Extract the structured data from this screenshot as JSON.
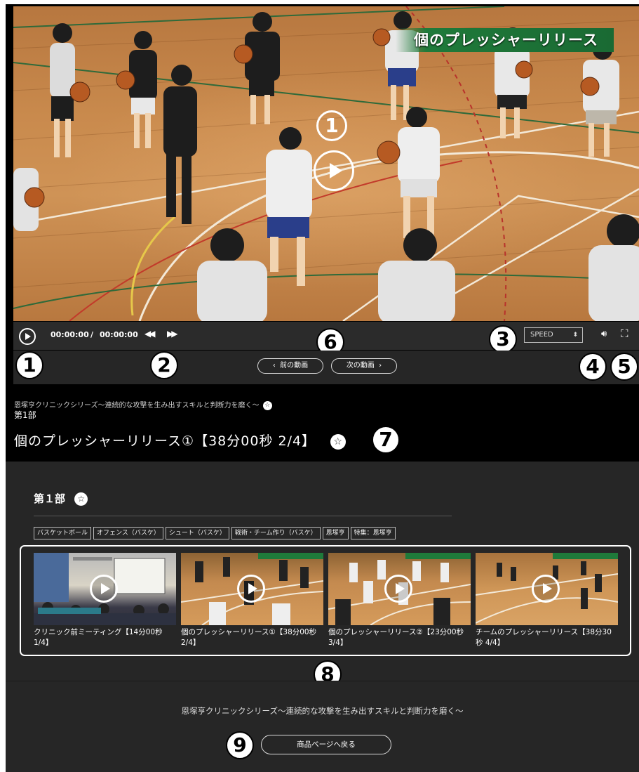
{
  "video": {
    "banner_title": "個のプレッシャーリリース",
    "time_current": "00:00:00",
    "time_separator": "/",
    "time_total": "00:00:00",
    "speed_label": "SPEED",
    "prev_button": "前の動画",
    "next_button": "次の動画",
    "icons": [
      "play-icon",
      "rewind-icon",
      "fast-forward-icon",
      "volume-icon",
      "fullscreen-icon",
      "chevron-left-icon",
      "chevron-right-icon"
    ]
  },
  "callouts": [
    "1",
    "2",
    "3",
    "4",
    "5",
    "6",
    "7",
    "8",
    "9"
  ],
  "lesson": {
    "series_title": "恩塚亨クリニックシリーズ～連続的な攻撃を生み出すスキルと判断力を磨く～",
    "part": "第1部",
    "title": "個のプレッシャーリリース①【38分00秒 2/4】",
    "star": "☆"
  },
  "part_panel": {
    "heading": "第１部",
    "tags": [
      "バスケットボール",
      "オフェンス（バスケ）",
      "シュート（バスケ）",
      "戦術・チーム作り（バスケ）",
      "恩塚亨",
      "特集：恩塚亨"
    ],
    "videos": [
      {
        "title": "クリニック前ミーティング【14分00秒 1/4】",
        "kind": "room"
      },
      {
        "title": "個のプレッシャーリリース①【38分00秒 2/4】",
        "kind": "court"
      },
      {
        "title": "個のプレッシャーリリース②【23分00秒 3/4】",
        "kind": "court"
      },
      {
        "title": "チームのプレッシャーリリース【38分30秒 4/4】",
        "kind": "court"
      }
    ]
  },
  "footer": {
    "series_title": "恩塚亨クリニックシリーズ～連続的な攻撃を生み出すスキルと判断力を磨く～",
    "back_button": "商品ページへ戻る"
  },
  "colors": {
    "background": "#000000",
    "panel": "#262626",
    "control_bar": "#2b2b2b",
    "banner_green": "#1f7a3a",
    "court": "#c98a4d"
  }
}
